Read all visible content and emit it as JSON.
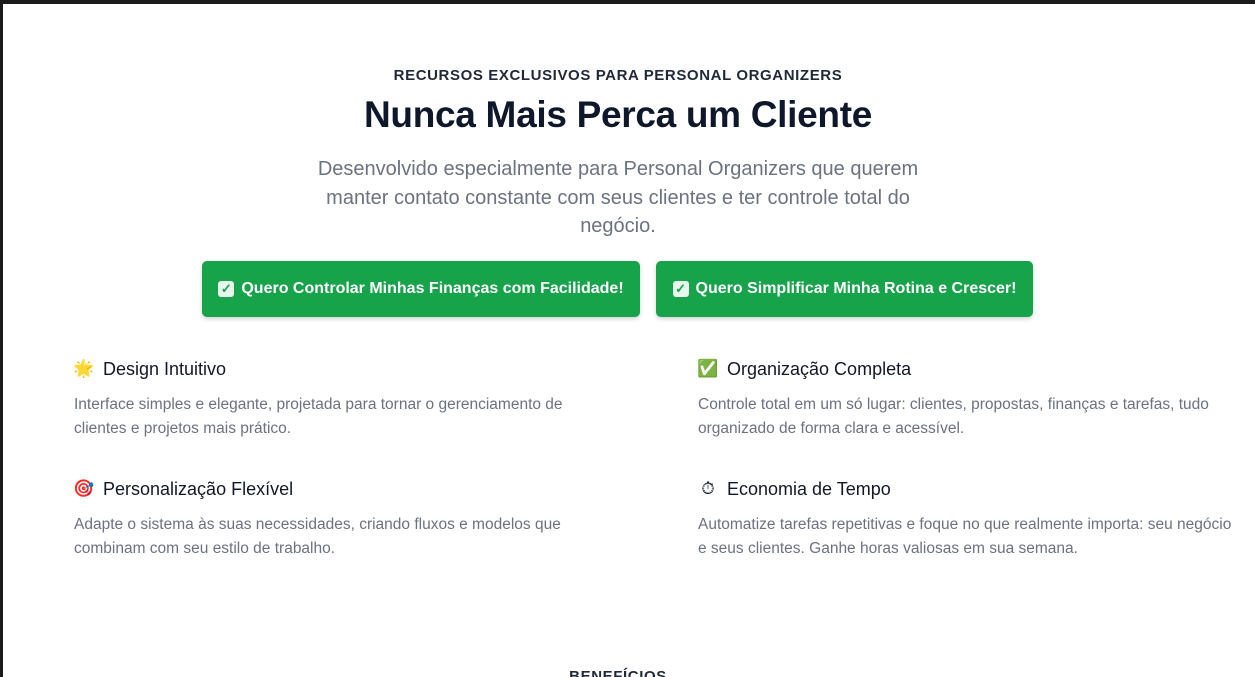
{
  "hero": {
    "eyebrow": "RECURSOS EXCLUSIVOS PARA PERSONAL ORGANIZERS",
    "headline": "Nunca Mais Perca um Cliente",
    "subtitle": "Desenvolvido especialmente para Personal Organizers que querem manter contato constante com seus clientes e ter controle total do negócio."
  },
  "cta": {
    "primary_label": "Quero Controlar Minhas Finanças com Facilidade!",
    "secondary_label": "Quero Simplificar Minha Rotina e Crescer!",
    "check_glyph": "✓",
    "button_color": "#16a34a"
  },
  "features": [
    {
      "icon": "sun-icon",
      "glyph": "🌟",
      "title": "Design Intuitivo",
      "description": "Interface simples e elegante, projetada para tornar o gerenciamento de clientes e projetos mais prático."
    },
    {
      "icon": "check-mark-icon",
      "glyph": "✅",
      "title": "Organização Completa",
      "description": "Controle total em um só lugar: clientes, propostas, finanças e tarefas, tudo organizado de forma clara e acessível."
    },
    {
      "icon": "target-icon",
      "glyph": "🎯",
      "title": "Personalização Flexível",
      "description": "Adapte o sistema às suas necessidades, criando fluxos e modelos que combinam com seu estilo de trabalho."
    },
    {
      "icon": "stopwatch-icon",
      "glyph": "⏱",
      "title": "Economia de Tempo",
      "description": "Automatize tarefas repetitivas e foque no que realmente importa: seu negócio e seus clientes. Ganhe horas valiosas em sua semana."
    }
  ],
  "next_section": {
    "label": "BENEFÍCIOS"
  }
}
